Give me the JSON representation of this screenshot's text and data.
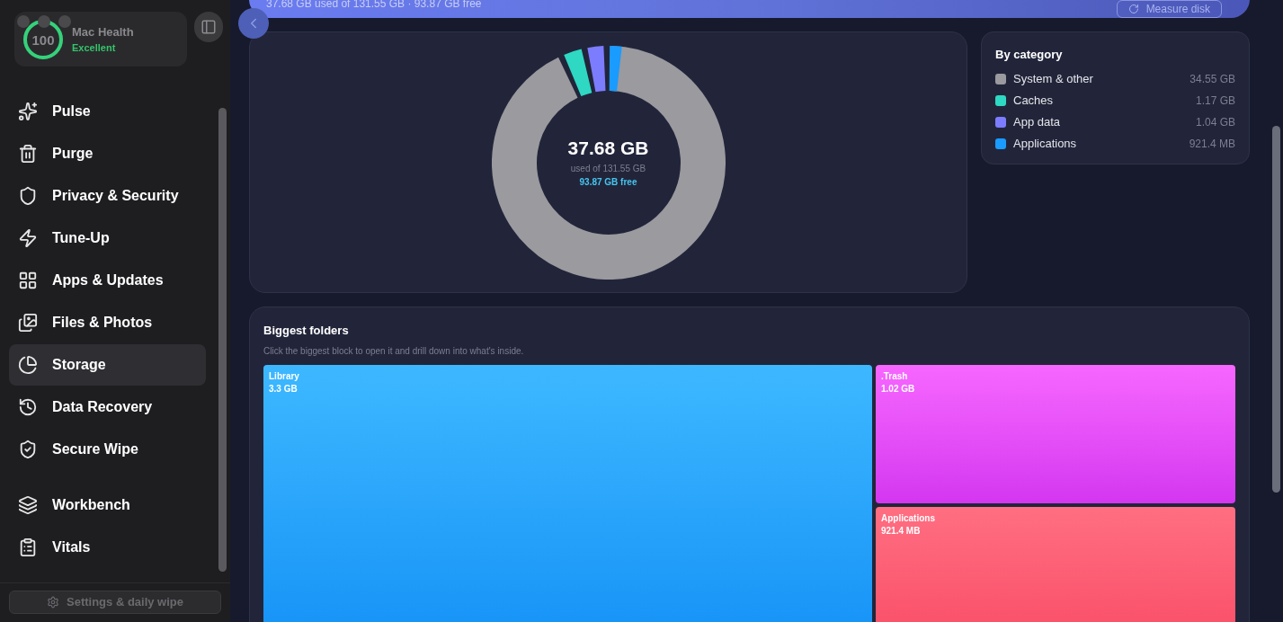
{
  "health": {
    "score": "100",
    "title": "Mac Health",
    "status": "Excellent",
    "level": 1
  },
  "sidebar": {
    "items": [
      {
        "label": "Pulse",
        "selected": false
      },
      {
        "label": "Purge",
        "selected": false
      },
      {
        "label": "Privacy & Security",
        "selected": false
      },
      {
        "label": "Tune-Up",
        "selected": false
      },
      {
        "label": "Apps & Updates",
        "selected": false
      },
      {
        "label": "Files & Photos",
        "selected": false
      },
      {
        "label": "Storage",
        "selected": true
      },
      {
        "label": "Data Recovery",
        "selected": false
      },
      {
        "label": "Secure Wipe",
        "selected": false
      }
    ],
    "tools": [
      {
        "label": "Workbench",
        "selected": false
      },
      {
        "label": "Vitals",
        "selected": false
      }
    ],
    "settings_button": "Settings & daily wipe"
  },
  "banner": {
    "summary": "37.68 GB used of 131.55 GB · 93.87 GB free",
    "button": "Measure disk"
  },
  "disk": {
    "used": "37.68 GB",
    "total": "used of 131.55 GB",
    "free": "93.87 GB free"
  },
  "by_category": {
    "title": "By category",
    "items": [
      {
        "name": "System & other",
        "size": "34.55 GB",
        "color": "#9a9a9f"
      },
      {
        "name": "Caches",
        "size": "1.17 GB",
        "color": "#2ed8c3"
      },
      {
        "name": "App data",
        "size": "1.04 GB",
        "color": "#7c7cff"
      },
      {
        "name": "Applications",
        "size": "921.4 MB",
        "color": "#1a9bff"
      }
    ]
  },
  "folders": {
    "title": "Biggest folders",
    "hint": "Click the biggest block to open it and drill down into what's inside.",
    "items": [
      {
        "name": "Library",
        "size": "3.3 GB",
        "kind": "blue"
      },
      {
        "name": ".Trash",
        "size": "1.02 GB",
        "kind": "magenta"
      },
      {
        "name": "Applications",
        "size": "921.4 MB",
        "kind": "red"
      }
    ]
  }
}
